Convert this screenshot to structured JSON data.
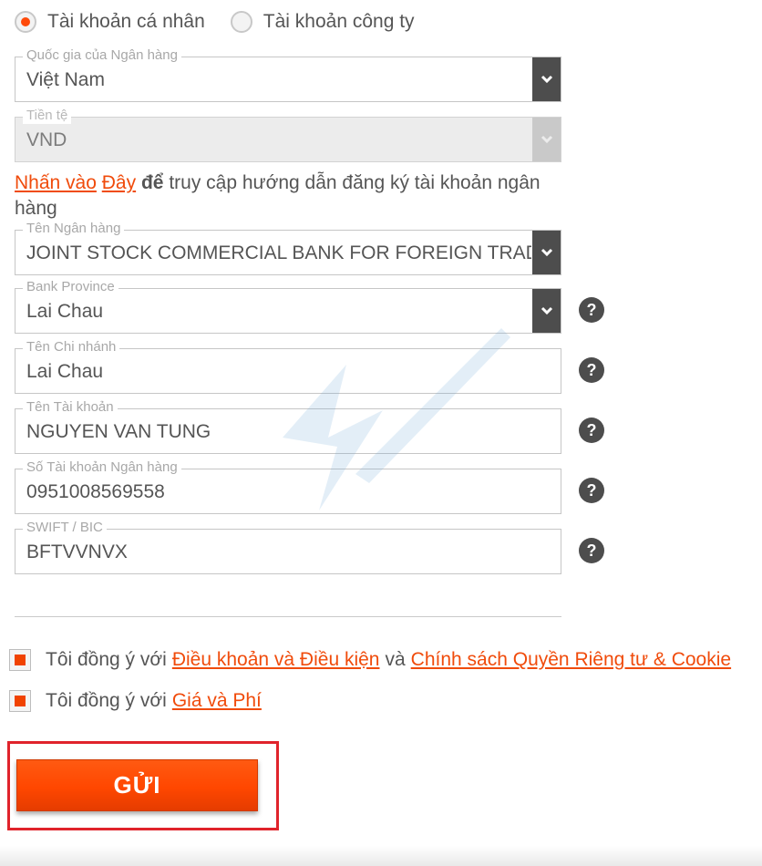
{
  "account_type": {
    "options": [
      {
        "label": "Tài khoản cá nhân",
        "checked": true
      },
      {
        "label": "Tài khoản công ty",
        "checked": false
      }
    ]
  },
  "fields": {
    "bank_country": {
      "label": "Quốc gia của Ngân hàng",
      "value": "Việt Nam"
    },
    "currency": {
      "label": "Tiền tệ",
      "value": "VND"
    },
    "bank_name": {
      "label": "Tên Ngân hàng",
      "value": "JOINT STOCK COMMERCIAL BANK FOR FOREIGN TRADE OF VIETNAM"
    },
    "bank_province": {
      "label": "Bank Province",
      "value": "Lai Chau"
    },
    "branch_name": {
      "label": "Tên Chi nhánh",
      "value": "Lai Chau"
    },
    "account_name": {
      "label": "Tên Tài khoản",
      "value": "NGUYEN VAN TUNG"
    },
    "account_number": {
      "label": "Số Tài khoản Ngân hàng",
      "value": "0951008569558"
    },
    "swift": {
      "label": "SWIFT / BIC",
      "value": "BFTVVNVX"
    }
  },
  "guide": {
    "link1": "Nhấn vào",
    "link2": "Đây",
    "bold_word": "để",
    "rest": "truy cập hướng dẫn đăng ký tài khoản ngân hàng"
  },
  "help_symbol": "?",
  "agreements": {
    "terms": {
      "prefix": "Tôi đồng ý với",
      "link_terms": "Điều khoản và Điều kiện",
      "conjunction": "và",
      "link_privacy": "Chính sách Quyền Riêng tư & Cookie",
      "checked": true
    },
    "fees": {
      "prefix": "Tôi đồng ý với",
      "link_fees": "Giá và Phí",
      "checked": true
    }
  },
  "submit_label": "GỬI",
  "colors": {
    "accent": "#ff4a0a",
    "link": "#f04b0b",
    "highlight_border": "#e0232b",
    "dark_control": "#4d4d4d"
  },
  "icons": {
    "dropdown": "chevron-down-icon",
    "help": "question-circle-icon"
  }
}
